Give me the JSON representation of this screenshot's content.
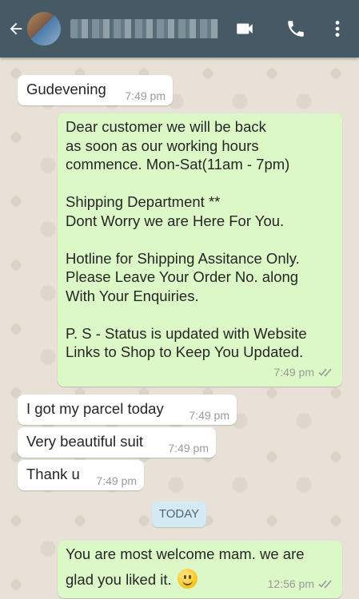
{
  "header": {
    "contact_name": "▪▪▪▪▪▪ ▪▪▪▪ ▪▪▪▪"
  },
  "messages": [
    {
      "direction": "incoming",
      "lines": [
        "Gudevening"
      ],
      "time": "7:49 pm"
    },
    {
      "direction": "outgoing",
      "lines": [
        "Dear customer we will be back",
        "as soon as our working hours",
        "commence. Mon-Sat(11am - 7pm)",
        "",
        "Shipping Department **",
        "Dont Worry we are Here For You.",
        "",
        "Hotline for Shipping Assitance Only.",
        "Please Leave Your Order No. along",
        "With Your Enquiries.",
        "",
        "P. S - Status is updated with Website",
        "Links to Shop to Keep You Updated."
      ],
      "time": "7:49 pm",
      "status": "read"
    },
    {
      "direction": "incoming",
      "lines": [
        "I got my parcel today"
      ],
      "time": "7:49 pm"
    },
    {
      "direction": "incoming",
      "lines": [
        "Very beautiful suit"
      ],
      "time": "7:49 pm"
    },
    {
      "direction": "incoming",
      "lines": [
        "Thank u"
      ],
      "time": "7:49 pm"
    },
    {
      "direction": "outgoing",
      "lines": [
        "You are most welcome mam. we are",
        "glad you liked it."
      ],
      "emoji": "smiling-face",
      "time": "12:56 pm",
      "status": "read"
    }
  ],
  "date_divider": "TODAY",
  "icons": [
    "back-arrow-icon",
    "video-call-icon",
    "phone-icon",
    "more-options-icon",
    "double-check-icon",
    "smiley-emoji"
  ],
  "colors": {
    "header": "#455a64",
    "outgoing_bubble": "#dcf8c6",
    "incoming_bubble": "#ffffff",
    "date_pill": "#d4eaf4",
    "read_tick": "#9a9a9a"
  }
}
